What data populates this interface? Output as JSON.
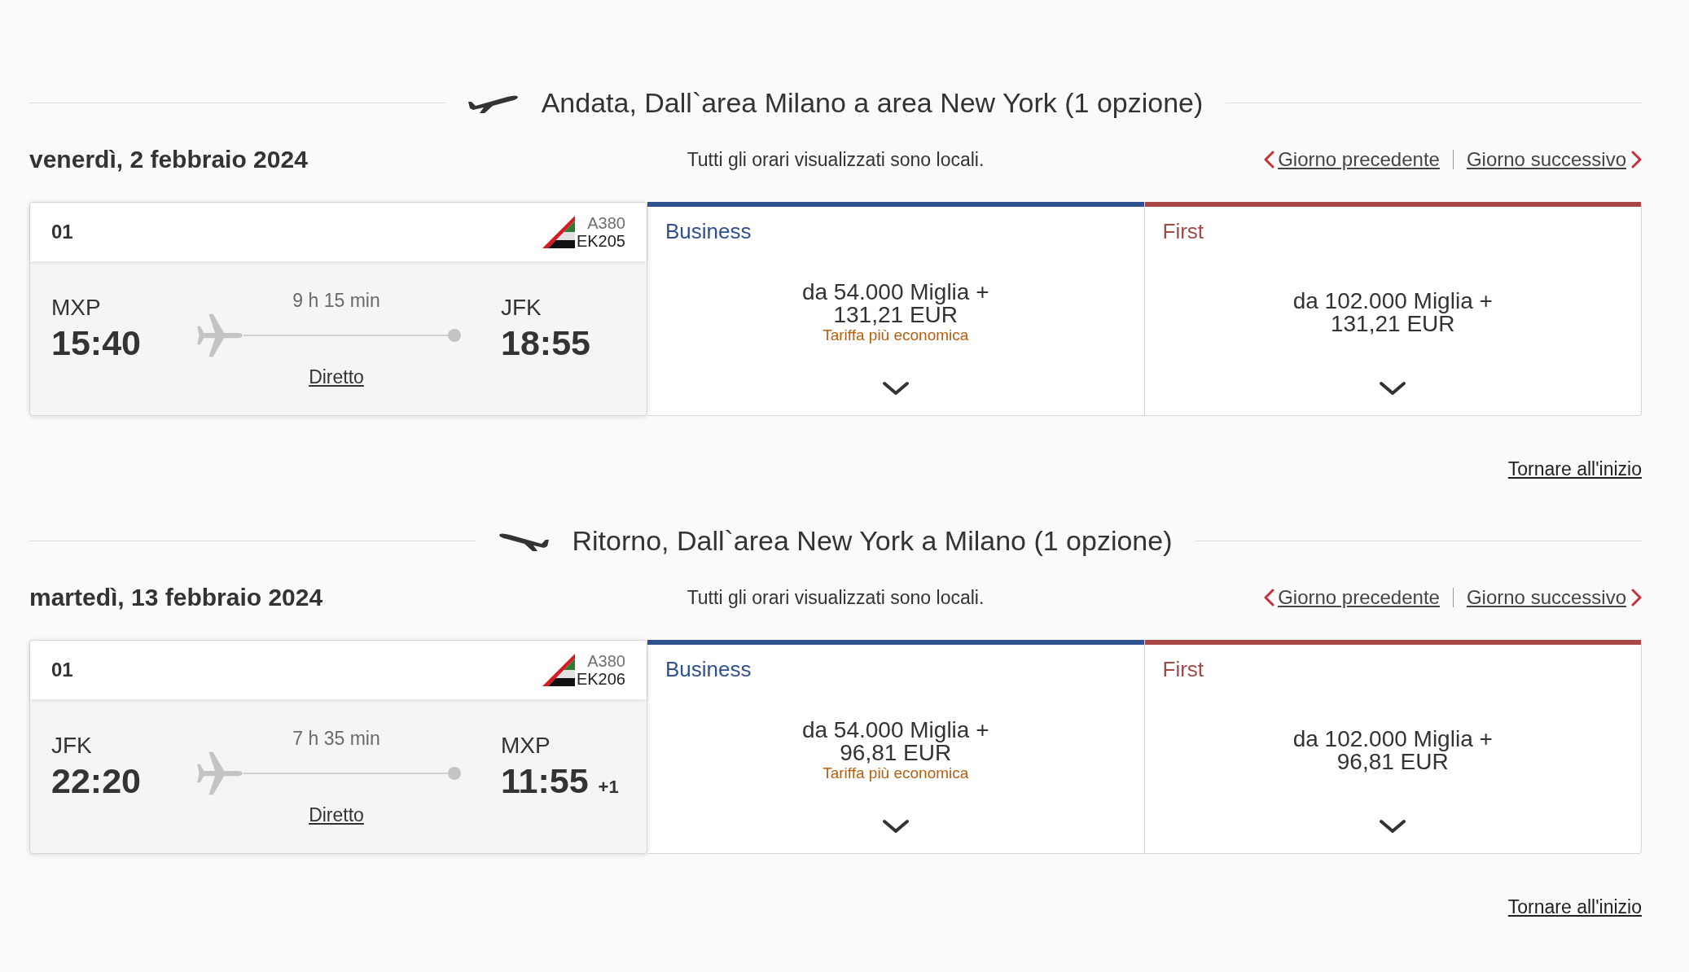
{
  "sections": [
    {
      "kind": "outbound",
      "title": "Andata, Dall`area Milano a area New York (1 opzione)",
      "date": "venerdì, 2 febbraio 2024",
      "note": "Tutti gli orari visualizzati sono locali.",
      "prev_day": "Giorno precedente",
      "next_day": "Giorno successivo",
      "flights": [
        {
          "number": "01",
          "aircraft": "A380",
          "flight_code": "EK205",
          "departure": {
            "airport": "MXP",
            "time": "15:40"
          },
          "arrival": {
            "airport": "JFK",
            "time": "18:55"
          },
          "duration": "9 h 15 min",
          "stops": "Diretto",
          "fares": [
            {
              "cabin": "Business",
              "color": "#30508f",
              "miles": "da 54.000 Miglia +",
              "amount": "131,21 EUR",
              "tag": "Tariffa più economica"
            },
            {
              "cabin": "First",
              "color": "#a84745",
              "miles": "da 102.000 Miglia +",
              "amount": "131,21 EUR"
            }
          ]
        }
      ],
      "back_to_top": "Tornare all'inizio"
    },
    {
      "kind": "return",
      "title": "Ritorno, Dall`area New York a Milano (1 opzione)",
      "date": "martedì, 13 febbraio 2024",
      "note": "Tutti gli orari visualizzati sono locali.",
      "prev_day": "Giorno precedente",
      "next_day": "Giorno successivo",
      "flights": [
        {
          "number": "01",
          "aircraft": "A380",
          "flight_code": "EK206",
          "departure": {
            "airport": "JFK",
            "time": "22:20"
          },
          "arrival": {
            "airport": "MXP",
            "time": "11:55",
            "day_offset": "+1"
          },
          "duration": "7 h 35 min",
          "stops": "Diretto",
          "fares": [
            {
              "cabin": "Business",
              "color": "#30508f",
              "miles": "da 54.000 Miglia +",
              "amount": "96,81 EUR",
              "tag": "Tariffa più economica"
            },
            {
              "cabin": "First",
              "color": "#a84745",
              "miles": "da 102.000 Miglia +",
              "amount": "96,81 EUR"
            }
          ]
        }
      ],
      "back_to_top": "Tornare all'inizio"
    }
  ]
}
